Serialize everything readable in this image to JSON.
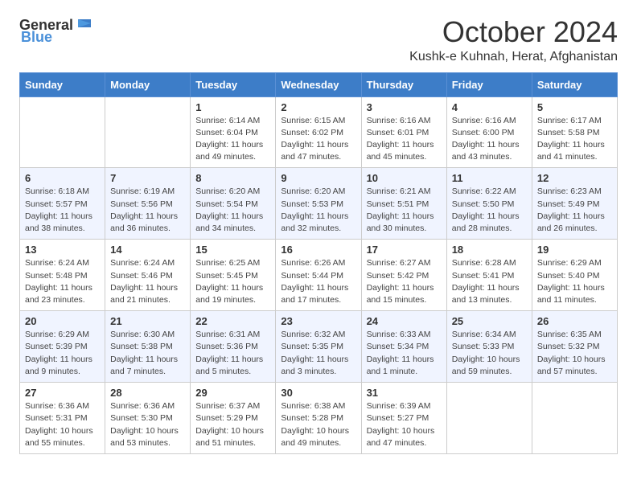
{
  "header": {
    "logo_general": "General",
    "logo_blue": "Blue",
    "month": "October 2024",
    "location": "Kushk-e Kuhnah, Herat, Afghanistan"
  },
  "weekdays": [
    "Sunday",
    "Monday",
    "Tuesday",
    "Wednesday",
    "Thursday",
    "Friday",
    "Saturday"
  ],
  "weeks": [
    [
      {
        "day": "",
        "sunrise": "",
        "sunset": "",
        "daylight": ""
      },
      {
        "day": "",
        "sunrise": "",
        "sunset": "",
        "daylight": ""
      },
      {
        "day": "1",
        "sunrise": "Sunrise: 6:14 AM",
        "sunset": "Sunset: 6:04 PM",
        "daylight": "Daylight: 11 hours and 49 minutes."
      },
      {
        "day": "2",
        "sunrise": "Sunrise: 6:15 AM",
        "sunset": "Sunset: 6:02 PM",
        "daylight": "Daylight: 11 hours and 47 minutes."
      },
      {
        "day": "3",
        "sunrise": "Sunrise: 6:16 AM",
        "sunset": "Sunset: 6:01 PM",
        "daylight": "Daylight: 11 hours and 45 minutes."
      },
      {
        "day": "4",
        "sunrise": "Sunrise: 6:16 AM",
        "sunset": "Sunset: 6:00 PM",
        "daylight": "Daylight: 11 hours and 43 minutes."
      },
      {
        "day": "5",
        "sunrise": "Sunrise: 6:17 AM",
        "sunset": "Sunset: 5:58 PM",
        "daylight": "Daylight: 11 hours and 41 minutes."
      }
    ],
    [
      {
        "day": "6",
        "sunrise": "Sunrise: 6:18 AM",
        "sunset": "Sunset: 5:57 PM",
        "daylight": "Daylight: 11 hours and 38 minutes."
      },
      {
        "day": "7",
        "sunrise": "Sunrise: 6:19 AM",
        "sunset": "Sunset: 5:56 PM",
        "daylight": "Daylight: 11 hours and 36 minutes."
      },
      {
        "day": "8",
        "sunrise": "Sunrise: 6:20 AM",
        "sunset": "Sunset: 5:54 PM",
        "daylight": "Daylight: 11 hours and 34 minutes."
      },
      {
        "day": "9",
        "sunrise": "Sunrise: 6:20 AM",
        "sunset": "Sunset: 5:53 PM",
        "daylight": "Daylight: 11 hours and 32 minutes."
      },
      {
        "day": "10",
        "sunrise": "Sunrise: 6:21 AM",
        "sunset": "Sunset: 5:51 PM",
        "daylight": "Daylight: 11 hours and 30 minutes."
      },
      {
        "day": "11",
        "sunrise": "Sunrise: 6:22 AM",
        "sunset": "Sunset: 5:50 PM",
        "daylight": "Daylight: 11 hours and 28 minutes."
      },
      {
        "day": "12",
        "sunrise": "Sunrise: 6:23 AM",
        "sunset": "Sunset: 5:49 PM",
        "daylight": "Daylight: 11 hours and 26 minutes."
      }
    ],
    [
      {
        "day": "13",
        "sunrise": "Sunrise: 6:24 AM",
        "sunset": "Sunset: 5:48 PM",
        "daylight": "Daylight: 11 hours and 23 minutes."
      },
      {
        "day": "14",
        "sunrise": "Sunrise: 6:24 AM",
        "sunset": "Sunset: 5:46 PM",
        "daylight": "Daylight: 11 hours and 21 minutes."
      },
      {
        "day": "15",
        "sunrise": "Sunrise: 6:25 AM",
        "sunset": "Sunset: 5:45 PM",
        "daylight": "Daylight: 11 hours and 19 minutes."
      },
      {
        "day": "16",
        "sunrise": "Sunrise: 6:26 AM",
        "sunset": "Sunset: 5:44 PM",
        "daylight": "Daylight: 11 hours and 17 minutes."
      },
      {
        "day": "17",
        "sunrise": "Sunrise: 6:27 AM",
        "sunset": "Sunset: 5:42 PM",
        "daylight": "Daylight: 11 hours and 15 minutes."
      },
      {
        "day": "18",
        "sunrise": "Sunrise: 6:28 AM",
        "sunset": "Sunset: 5:41 PM",
        "daylight": "Daylight: 11 hours and 13 minutes."
      },
      {
        "day": "19",
        "sunrise": "Sunrise: 6:29 AM",
        "sunset": "Sunset: 5:40 PM",
        "daylight": "Daylight: 11 hours and 11 minutes."
      }
    ],
    [
      {
        "day": "20",
        "sunrise": "Sunrise: 6:29 AM",
        "sunset": "Sunset: 5:39 PM",
        "daylight": "Daylight: 11 hours and 9 minutes."
      },
      {
        "day": "21",
        "sunrise": "Sunrise: 6:30 AM",
        "sunset": "Sunset: 5:38 PM",
        "daylight": "Daylight: 11 hours and 7 minutes."
      },
      {
        "day": "22",
        "sunrise": "Sunrise: 6:31 AM",
        "sunset": "Sunset: 5:36 PM",
        "daylight": "Daylight: 11 hours and 5 minutes."
      },
      {
        "day": "23",
        "sunrise": "Sunrise: 6:32 AM",
        "sunset": "Sunset: 5:35 PM",
        "daylight": "Daylight: 11 hours and 3 minutes."
      },
      {
        "day": "24",
        "sunrise": "Sunrise: 6:33 AM",
        "sunset": "Sunset: 5:34 PM",
        "daylight": "Daylight: 11 hours and 1 minute."
      },
      {
        "day": "25",
        "sunrise": "Sunrise: 6:34 AM",
        "sunset": "Sunset: 5:33 PM",
        "daylight": "Daylight: 10 hours and 59 minutes."
      },
      {
        "day": "26",
        "sunrise": "Sunrise: 6:35 AM",
        "sunset": "Sunset: 5:32 PM",
        "daylight": "Daylight: 10 hours and 57 minutes."
      }
    ],
    [
      {
        "day": "27",
        "sunrise": "Sunrise: 6:36 AM",
        "sunset": "Sunset: 5:31 PM",
        "daylight": "Daylight: 10 hours and 55 minutes."
      },
      {
        "day": "28",
        "sunrise": "Sunrise: 6:36 AM",
        "sunset": "Sunset: 5:30 PM",
        "daylight": "Daylight: 10 hours and 53 minutes."
      },
      {
        "day": "29",
        "sunrise": "Sunrise: 6:37 AM",
        "sunset": "Sunset: 5:29 PM",
        "daylight": "Daylight: 10 hours and 51 minutes."
      },
      {
        "day": "30",
        "sunrise": "Sunrise: 6:38 AM",
        "sunset": "Sunset: 5:28 PM",
        "daylight": "Daylight: 10 hours and 49 minutes."
      },
      {
        "day": "31",
        "sunrise": "Sunrise: 6:39 AM",
        "sunset": "Sunset: 5:27 PM",
        "daylight": "Daylight: 10 hours and 47 minutes."
      },
      {
        "day": "",
        "sunrise": "",
        "sunset": "",
        "daylight": ""
      },
      {
        "day": "",
        "sunrise": "",
        "sunset": "",
        "daylight": ""
      }
    ]
  ]
}
